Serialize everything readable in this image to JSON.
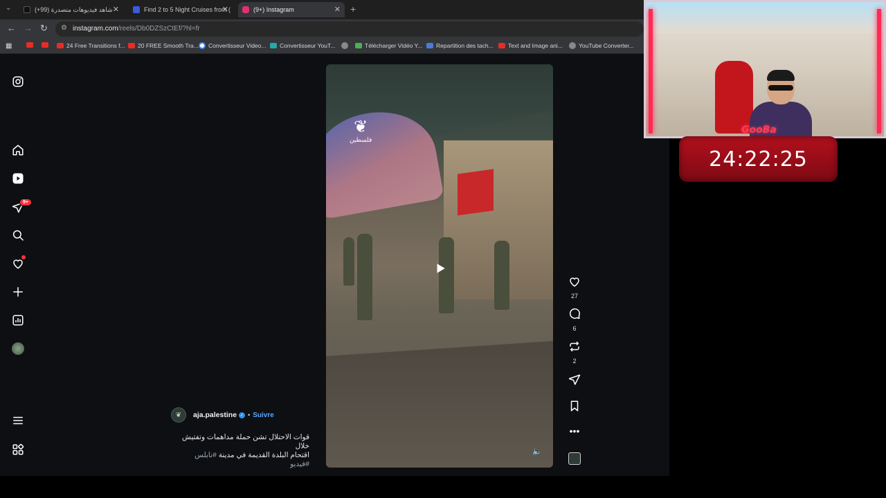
{
  "browser": {
    "tabs": [
      {
        "label": "شاهد فيديوهات متصدرة (99+)",
        "favicon_color": "#111111"
      },
      {
        "label": "Find 2 to 5 Night Cruises from (",
        "favicon_color": "#3b5bdb"
      },
      {
        "label": "(9+) Instagram",
        "favicon_color": "#e1306c"
      }
    ],
    "url_main": "instagram.com",
    "url_path": "/reels/Db0DZSzCtEf/?hl=fr",
    "bookmarks": [
      {
        "label": "",
        "icon": "youtube-icon"
      },
      {
        "label": "",
        "icon": "youtube-icon"
      },
      {
        "label": "24 Free Transitions f...",
        "icon": "youtube-icon"
      },
      {
        "label": "20 FREE Smooth Tra...",
        "icon": "youtube-icon"
      },
      {
        "label": "Convertisseur Video...",
        "icon": "google-icon"
      },
      {
        "label": "Convertisseur YouT...",
        "icon": "converter-icon"
      },
      {
        "label": "",
        "icon": "globe-icon"
      },
      {
        "label": "Télécharger Vidéo Y...",
        "icon": "download-icon"
      },
      {
        "label": "Repartition des tach...",
        "icon": "docs-icon"
      },
      {
        "label": "Text and Image ani...",
        "icon": "youtube-icon"
      },
      {
        "label": "YouTube Converter...",
        "icon": "globe-icon"
      }
    ]
  },
  "sidebar": {
    "notifications_badge": "9+"
  },
  "reel": {
    "watermark": "فلسطين",
    "actions": {
      "likes": "27",
      "comments": "6",
      "reposts": "2"
    },
    "author": {
      "username": "aja.palestine",
      "follow_label": "Suivre",
      "separator": "•"
    },
    "caption_line1": "قوات الاحتلال تشن حملة مداهمات وتفتيش خلال",
    "caption_line2": "اقتحام البلدة القديمة في مدينة",
    "caption_tag1": "#نابلس",
    "caption_tag2": "#فيديو"
  },
  "overlay": {
    "streamer_name": "GooBa",
    "timer": "24:22:25"
  },
  "colors": {
    "accent_follow": "#5aa8ff",
    "badge": "#ff3040",
    "timer_bg": "#b3101c"
  }
}
